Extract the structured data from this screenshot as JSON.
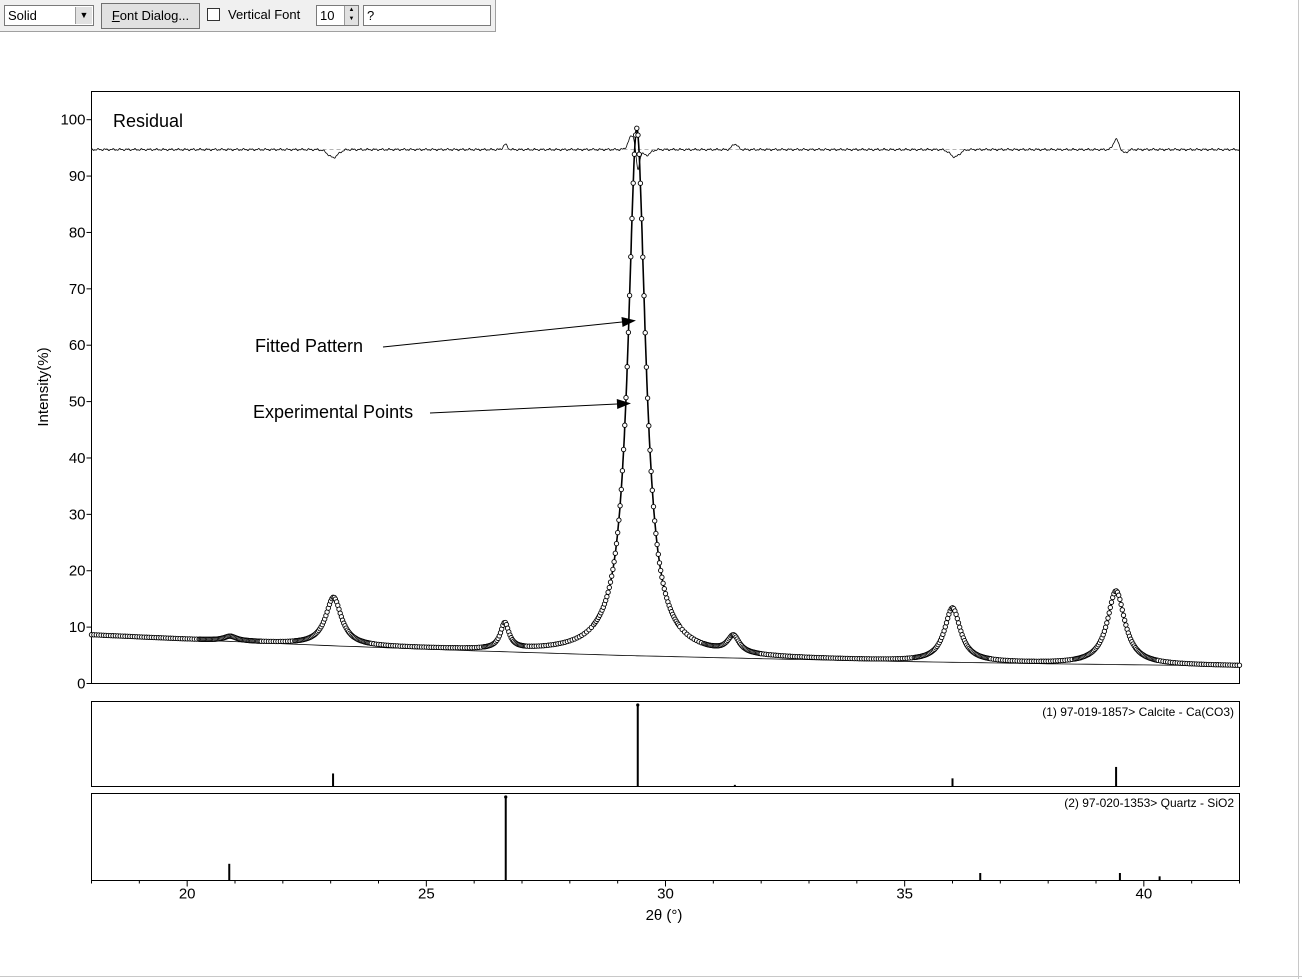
{
  "toolbar": {
    "line_style": "Solid",
    "font_dialog_label": "Font Dialog...",
    "font_dialog_mnemonic": "F",
    "font_dialog_rest": "ont Dialog...",
    "vertical_font_label": "Vertical Font",
    "vertical_font_checked": false,
    "font_size": "10",
    "text_value": "?"
  },
  "chart_data": {
    "type": "line",
    "xlabel": "2θ (°)",
    "ylabel": "Intensity(%)",
    "xlim": [
      18,
      42
    ],
    "ylim": [
      0,
      105
    ],
    "xticks": [
      20,
      25,
      30,
      35,
      40
    ],
    "yticks": [
      0,
      10,
      20,
      30,
      40,
      50,
      60,
      70,
      80,
      90,
      100
    ],
    "grid": false,
    "annotations": [
      {
        "text": "Residual",
        "role": "label"
      },
      {
        "text": "Fitted Pattern",
        "points_to": [
          29.4,
          64
        ]
      },
      {
        "text": "Experimental Points",
        "points_to": [
          29.35,
          49.5
        ]
      }
    ],
    "background": {
      "x": [
        18,
        20,
        23,
        26,
        29,
        32,
        35,
        38,
        42
      ],
      "y": [
        8.6,
        7.8,
        6.7,
        5.8,
        5.0,
        4.4,
        3.9,
        3.5,
        3.1
      ]
    },
    "peaks": [
      {
        "x": 20.9,
        "height": 0.8,
        "width": 0.16
      },
      {
        "x": 23.06,
        "height": 8.5,
        "width": 0.2
      },
      {
        "x": 26.64,
        "height": 4.6,
        "width": 0.11
      },
      {
        "x": 29.4,
        "height": 93.5,
        "width": 0.22
      },
      {
        "x": 31.42,
        "height": 3.0,
        "width": 0.15
      },
      {
        "x": 36.0,
        "height": 9.5,
        "width": 0.2
      },
      {
        "x": 39.42,
        "height": 13.0,
        "width": 0.22
      }
    ],
    "residual": {
      "baseline": 94.7,
      "features": [
        {
          "x": 23.05,
          "amp": -1.4,
          "width": 0.15
        },
        {
          "x": 26.65,
          "amp": 0.9,
          "width": 0.06
        },
        {
          "x": 29.3,
          "amp": 2.5,
          "width": 0.1
        },
        {
          "x": 29.42,
          "amp": -4.0,
          "width": 0.05
        },
        {
          "x": 29.6,
          "amp": -1.0,
          "width": 0.12
        },
        {
          "x": 31.45,
          "amp": 1.0,
          "width": 0.08
        },
        {
          "x": 36.05,
          "amp": -1.3,
          "width": 0.14
        },
        {
          "x": 39.42,
          "amp": 1.8,
          "width": 0.08
        },
        {
          "x": 39.6,
          "amp": -0.6,
          "width": 0.08
        }
      ]
    },
    "reference_panels": [
      {
        "label": "(1) 97-019-1857> Calcite - Ca(CO3)",
        "sticks": [
          {
            "x": 23.05,
            "rel": 0.16
          },
          {
            "x": 29.42,
            "rel": 1.0
          },
          {
            "x": 31.45,
            "rel": 0.02
          },
          {
            "x": 36.0,
            "rel": 0.1
          },
          {
            "x": 39.42,
            "rel": 0.24
          }
        ]
      },
      {
        "label": "(2) 97-020-1353> Quartz - SiO2",
        "sticks": [
          {
            "x": 20.88,
            "rel": 0.2
          },
          {
            "x": 26.66,
            "rel": 1.0
          },
          {
            "x": 36.58,
            "rel": 0.09
          },
          {
            "x": 39.5,
            "rel": 0.09
          },
          {
            "x": 40.33,
            "rel": 0.05
          }
        ]
      }
    ]
  }
}
